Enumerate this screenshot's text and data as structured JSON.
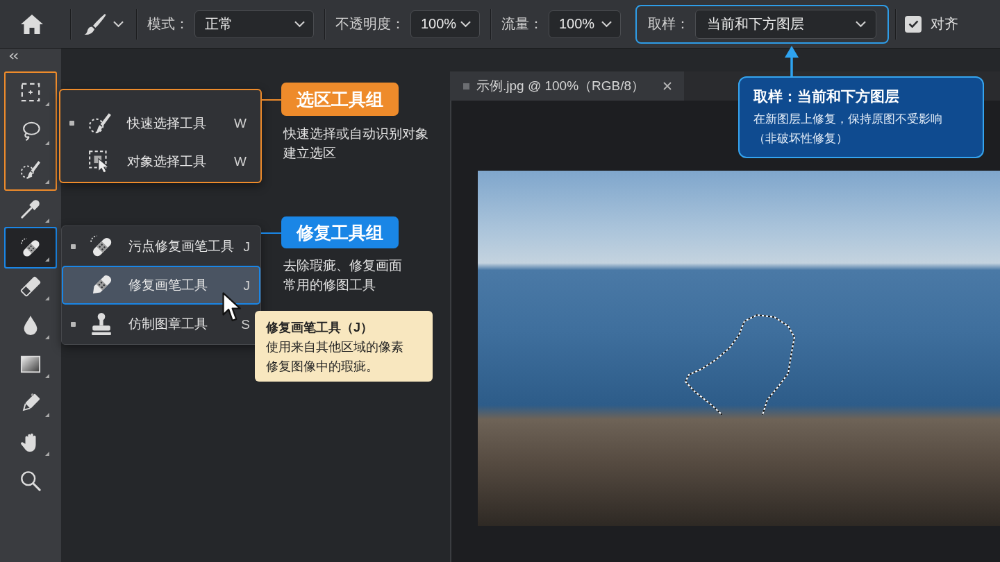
{
  "options_bar": {
    "controls": [
      {
        "kind": "home"
      },
      {
        "kind": "brush_preset"
      },
      {
        "kind": "dropdown",
        "label": "模式：",
        "value": "正常",
        "highlighted": false
      },
      {
        "kind": "dropdown",
        "label": "不透明度：",
        "value": "100%",
        "highlighted": false
      },
      {
        "kind": "dropdown",
        "label": "流量：",
        "value": "100%",
        "highlighted": false
      },
      {
        "kind": "dropdown",
        "label": "取样：",
        "value": "当前和下方图层",
        "highlighted": true,
        "callout": {
          "title": "取样：当前和下方图层",
          "text": "在新图层上修复，保持原图不受影响（非破坏性修复）"
        }
      },
      {
        "kind": "checkbox",
        "label": "对齐",
        "checked": true
      }
    ]
  },
  "toolbar": {
    "segments": [
      {
        "kind": "group",
        "color": "#ee8b2b",
        "tag": "选区工具组",
        "description": "快速选择或自动识别对象建立选区",
        "tools": [
          {
            "kind": "marquee",
            "selected": false,
            "flyout": true
          },
          {
            "kind": "lasso",
            "selected": false,
            "flyout": true
          },
          {
            "kind": "quick_select",
            "selected": false,
            "flyout": true
          }
        ],
        "flyout": {
          "framed": true,
          "items": [
            {
              "kind": "quick_select",
              "label": "快速选择工具",
              "shortcut": "W",
              "bullet": true,
              "selected": false
            },
            {
              "kind": "object_select",
              "label": "对象选择工具",
              "shortcut": "W",
              "bullet": false,
              "selected": false
            }
          ]
        }
      },
      {
        "kind": "plain",
        "tools": [
          {
            "kind": "eyedropper",
            "selected": false,
            "flyout": true
          }
        ]
      },
      {
        "kind": "group",
        "color": "#1a86e6",
        "tag": "修复工具组",
        "description": "去除瑕疵、修复画面常用的修图工具",
        "tools": [
          {
            "kind": "healing",
            "selected": true,
            "flyout": true
          }
        ],
        "flyout": {
          "framed": false,
          "items": [
            {
              "kind": "spot_healing",
              "label": "污点修复画笔工具",
              "shortcut": "J",
              "bullet": true,
              "selected": false
            },
            {
              "kind": "healing_brush",
              "label": "修复画笔工具",
              "shortcut": "J",
              "bullet": false,
              "selected": true
            },
            {
              "kind": "clone_stamp",
              "label": "仿制图章工具",
              "shortcut": "S",
              "bullet": true,
              "selected": false
            }
          ]
        },
        "tooltip": {
          "title": "修复画笔工具（J）",
          "text": "使用来自其他区域的像素修复图像中的瑕疵。"
        }
      },
      {
        "kind": "plain",
        "tools": [
          {
            "kind": "eraser",
            "selected": false,
            "flyout": true
          },
          {
            "kind": "blur",
            "selected": false,
            "flyout": true
          },
          {
            "kind": "gradient",
            "selected": false,
            "flyout": true
          },
          {
            "kind": "pencil",
            "selected": false,
            "flyout": true
          },
          {
            "kind": "hand",
            "selected": false,
            "flyout": true
          },
          {
            "kind": "zoom",
            "selected": false,
            "flyout": false
          }
        ]
      }
    ]
  },
  "document": {
    "tab_title": "示例.jpg @ 100%（RGB/8）",
    "selection_active": true
  }
}
